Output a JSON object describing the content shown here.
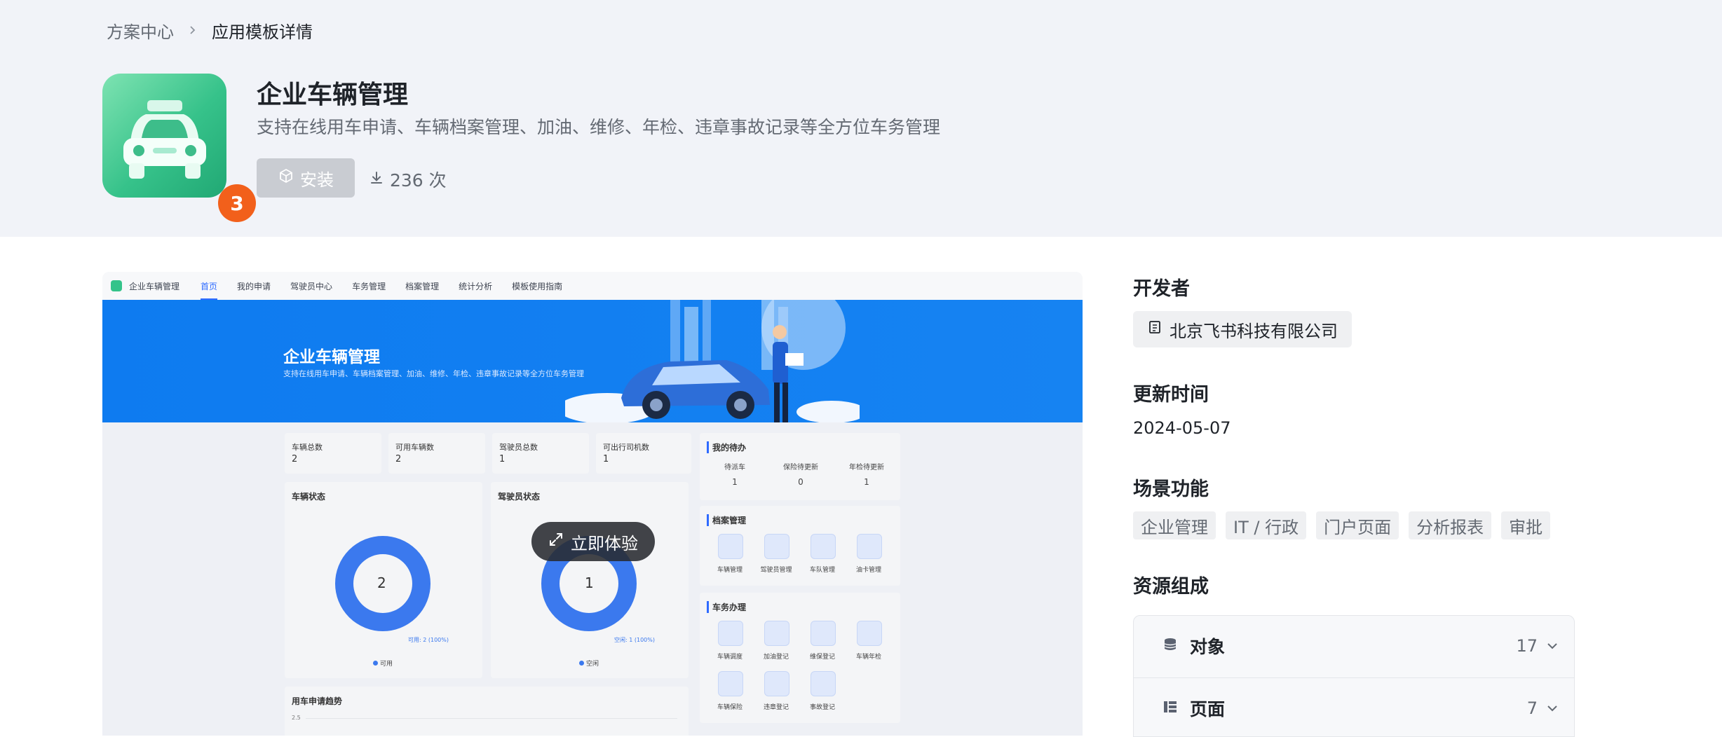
{
  "breadcrumb": {
    "parent": "方案中心",
    "current": "应用模板详情"
  },
  "app": {
    "title": "企业车辆管理",
    "description": "支持在线用车申请、车辆档案管理、加油、维修、年检、违章事故记录等全方位车务管理",
    "install_label": "安装",
    "downloads": "236 次",
    "badge_count": "3"
  },
  "preview": {
    "nav": [
      "企业车辆管理",
      "首页",
      "我的申请",
      "驾驶员中心",
      "车务管理",
      "档案管理",
      "统计分析",
      "模板使用指南"
    ],
    "banner_title": "企业车辆管理",
    "banner_subtitle": "支持在线用车申请、车辆档案管理、加油、维修、年检、违章事故记录等全方位车务管理",
    "stats": [
      {
        "label": "车辆总数",
        "value": "2"
      },
      {
        "label": "可用车辆数",
        "value": "2"
      },
      {
        "label": "驾驶员总数",
        "value": "1"
      },
      {
        "label": "可出行司机数",
        "value": "1"
      }
    ],
    "vehicle_status": {
      "title": "车辆状态",
      "center": "2",
      "callout": "可用: 2 (100%)",
      "legend": "可用"
    },
    "driver_status": {
      "title": "驾驶员状态",
      "center": "1",
      "callout": "空闲: 1 (100%)",
      "legend": "空闲"
    },
    "todo": {
      "title": "我的待办",
      "items": [
        {
          "label": "待派车",
          "value": "1"
        },
        {
          "label": "保险待更新",
          "value": "0"
        },
        {
          "label": "年检待更新",
          "value": "1"
        }
      ]
    },
    "archive": {
      "title": "档案管理",
      "items": [
        "车辆管理",
        "驾驶员管理",
        "车队管理",
        "油卡管理"
      ]
    },
    "affairs": {
      "title": "车务办理",
      "items": [
        "车辆调度",
        "加油登记",
        "维保登记",
        "车辆年检",
        "车辆保险",
        "违章登记",
        "事故登记"
      ]
    },
    "trend_title": "用车申请趋势",
    "trend_axis": "2.5",
    "experience_button": "立即体验"
  },
  "developer": {
    "heading": "开发者",
    "name": "北京飞书科技有限公司"
  },
  "updated": {
    "heading": "更新时间",
    "date": "2024-05-07"
  },
  "scenes": {
    "heading": "场景功能",
    "tags": [
      "企业管理",
      "IT / 行政",
      "门户页面",
      "分析报表",
      "审批"
    ]
  },
  "resources": {
    "heading": "资源组成",
    "items": [
      {
        "name": "对象",
        "count": "17"
      },
      {
        "name": "页面",
        "count": "7"
      }
    ]
  },
  "colors": {
    "accent": "#2f6bff",
    "badge": "#f2601b",
    "app_icon": "#36c28a",
    "banner": "#0e7bf0"
  },
  "icons": [
    "chevron-right-icon",
    "cube-icon",
    "download-icon",
    "document-icon",
    "database-icon",
    "layout-icon",
    "chevron-down-icon",
    "expand-icon"
  ]
}
